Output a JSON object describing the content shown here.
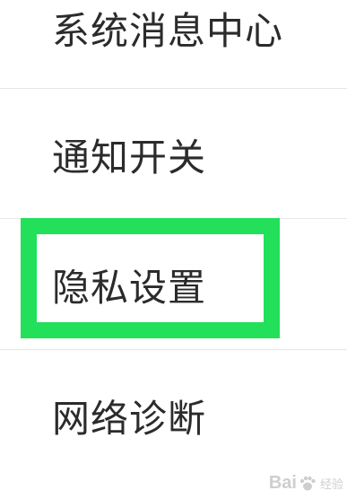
{
  "menu": {
    "items": [
      {
        "label": "系统消息中心"
      },
      {
        "label": "通知开关"
      },
      {
        "label": "隐私设置"
      },
      {
        "label": "网络诊断"
      }
    ]
  },
  "highlight": {
    "target": "隐私设置",
    "color": "#22e05a"
  },
  "watermark": {
    "brand": "Bai",
    "suffix": "经验"
  }
}
